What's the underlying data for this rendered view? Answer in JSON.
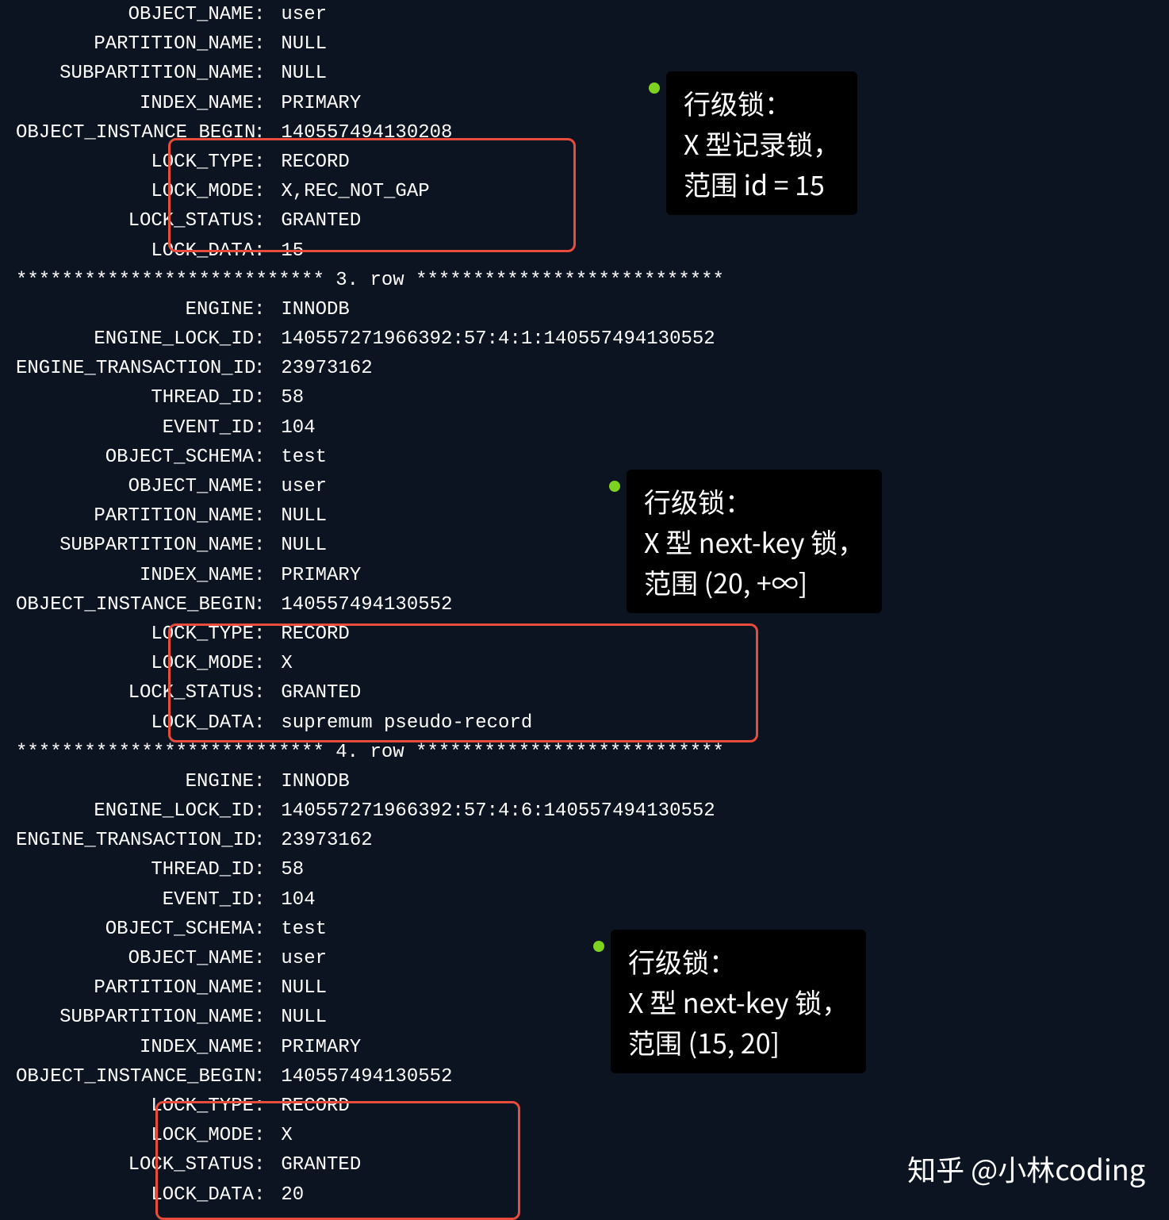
{
  "rows": [
    {
      "fields": [
        {
          "key": "OBJECT_NAME",
          "val": "user"
        },
        {
          "key": "PARTITION_NAME",
          "val": "NULL"
        },
        {
          "key": "SUBPARTITION_NAME",
          "val": "NULL"
        },
        {
          "key": "INDEX_NAME",
          "val": "PRIMARY"
        },
        {
          "key": "OBJECT_INSTANCE_BEGIN",
          "val": "140557494130208"
        },
        {
          "key": "LOCK_TYPE",
          "val": "RECORD"
        },
        {
          "key": "LOCK_MODE",
          "val": "X,REC_NOT_GAP"
        },
        {
          "key": "LOCK_STATUS",
          "val": "GRANTED"
        },
        {
          "key": "LOCK_DATA",
          "val": "15"
        }
      ]
    },
    {
      "separator": "*************************** 3. row ***************************",
      "fields": [
        {
          "key": "ENGINE",
          "val": "INNODB"
        },
        {
          "key": "ENGINE_LOCK_ID",
          "val": "140557271966392:57:4:1:140557494130552"
        },
        {
          "key": "ENGINE_TRANSACTION_ID",
          "val": "23973162"
        },
        {
          "key": "THREAD_ID",
          "val": "58"
        },
        {
          "key": "EVENT_ID",
          "val": "104"
        },
        {
          "key": "OBJECT_SCHEMA",
          "val": "test"
        },
        {
          "key": "OBJECT_NAME",
          "val": "user"
        },
        {
          "key": "PARTITION_NAME",
          "val": "NULL"
        },
        {
          "key": "SUBPARTITION_NAME",
          "val": "NULL"
        },
        {
          "key": "INDEX_NAME",
          "val": "PRIMARY"
        },
        {
          "key": "OBJECT_INSTANCE_BEGIN",
          "val": "140557494130552"
        },
        {
          "key": "LOCK_TYPE",
          "val": "RECORD"
        },
        {
          "key": "LOCK_MODE",
          "val": "X"
        },
        {
          "key": "LOCK_STATUS",
          "val": "GRANTED"
        },
        {
          "key": "LOCK_DATA",
          "val": "supremum pseudo-record"
        }
      ]
    },
    {
      "separator": "*************************** 4. row ***************************",
      "fields": [
        {
          "key": "ENGINE",
          "val": "INNODB"
        },
        {
          "key": "ENGINE_LOCK_ID",
          "val": "140557271966392:57:4:6:140557494130552"
        },
        {
          "key": "ENGINE_TRANSACTION_ID",
          "val": "23973162"
        },
        {
          "key": "THREAD_ID",
          "val": "58"
        },
        {
          "key": "EVENT_ID",
          "val": "104"
        },
        {
          "key": "OBJECT_SCHEMA",
          "val": "test"
        },
        {
          "key": "OBJECT_NAME",
          "val": "user"
        },
        {
          "key": "PARTITION_NAME",
          "val": "NULL"
        },
        {
          "key": "SUBPARTITION_NAME",
          "val": "NULL"
        },
        {
          "key": "INDEX_NAME",
          "val": "PRIMARY"
        },
        {
          "key": "OBJECT_INSTANCE_BEGIN",
          "val": "140557494130552"
        },
        {
          "key": "LOCK_TYPE",
          "val": "RECORD"
        },
        {
          "key": "LOCK_MODE",
          "val": "X"
        },
        {
          "key": "LOCK_STATUS",
          "val": "GRANTED"
        },
        {
          "key": "LOCK_DATA",
          "val": "20"
        }
      ]
    }
  ],
  "annotations": [
    {
      "l1": "行级锁：",
      "l2": "X 型记录锁，",
      "l3": "范围 id = 15"
    },
    {
      "l1": "行级锁：",
      "l2": "X 型 next-key 锁，",
      "l3": "范围 (20, +∞]"
    },
    {
      "l1": "行级锁：",
      "l2": "X 型 next-key 锁，",
      "l3": "范围 (15, 20]"
    }
  ],
  "watermark": "知乎 @小林coding"
}
